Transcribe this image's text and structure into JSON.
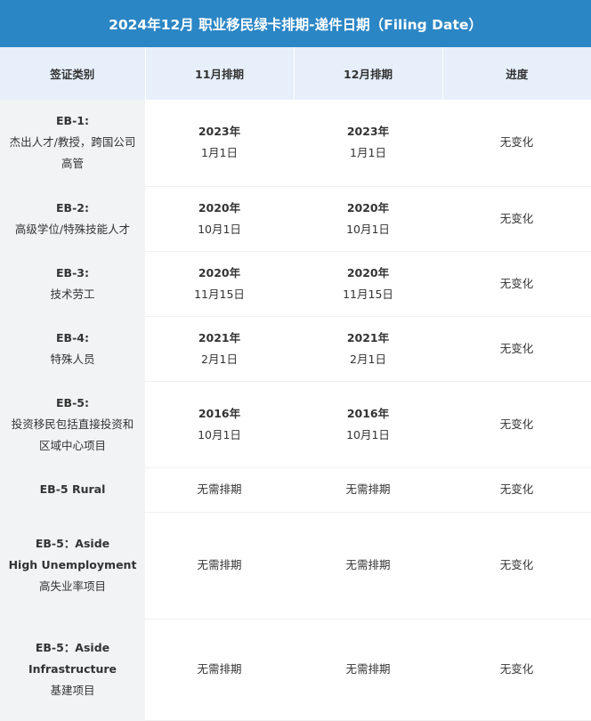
{
  "title": "2024年12月 职业移民绿卡排期-递件日期（Filing Date）",
  "headers": [
    "签证类别",
    "11月排期",
    "12月排期",
    "进度"
  ],
  "rows": [
    {
      "code": "EB-1:",
      "desc": [
        "杰出人才/教授，跨国公司",
        "高管"
      ],
      "nov": {
        "year": "2023年",
        "day": "1月1日"
      },
      "dec": {
        "year": "2023年",
        "day": "1月1日"
      },
      "progress": "无变化"
    },
    {
      "code": "EB-2:",
      "desc": [
        "高级学位/特殊技能人才"
      ],
      "nov": {
        "year": "2020年",
        "day": "10月1日"
      },
      "dec": {
        "year": "2020年",
        "day": "10月1日"
      },
      "progress": "无变化"
    },
    {
      "code": "EB-3:",
      "desc": [
        "技术劳工"
      ],
      "nov": {
        "year": "2020年",
        "day": "11月15日"
      },
      "dec": {
        "year": "2020年",
        "day": "11月15日"
      },
      "progress": "无变化"
    },
    {
      "code": "EB-4:",
      "desc": [
        "特殊人员"
      ],
      "nov": {
        "year": "2021年",
        "day": "2月1日"
      },
      "dec": {
        "year": "2021年",
        "day": "2月1日"
      },
      "progress": "无变化"
    },
    {
      "code": "EB-5:",
      "desc": [
        "投资移民包括直接投资和",
        "区域中心项目"
      ],
      "nov": {
        "year": "2016年",
        "day": "10月1日"
      },
      "dec": {
        "year": "2016年",
        "day": "10月1日"
      },
      "progress": "无变化"
    },
    {
      "code": "EB-5 Rural",
      "desc": [],
      "nov_text": "无需排期",
      "dec_text": "无需排期",
      "progress": "无变化"
    },
    {
      "code": "EB-5：Aside",
      "code2": "High Unemployment",
      "desc": [
        "高失业率项目"
      ],
      "nov_text": "无需排期",
      "dec_text": "无需排期",
      "progress": "无变化"
    },
    {
      "code": "EB-5：Aside",
      "code2": "Infrastructure",
      "desc": [
        "基建项目"
      ],
      "nov_text": "无需排期",
      "dec_text": "无需排期",
      "progress": "无变化"
    }
  ]
}
